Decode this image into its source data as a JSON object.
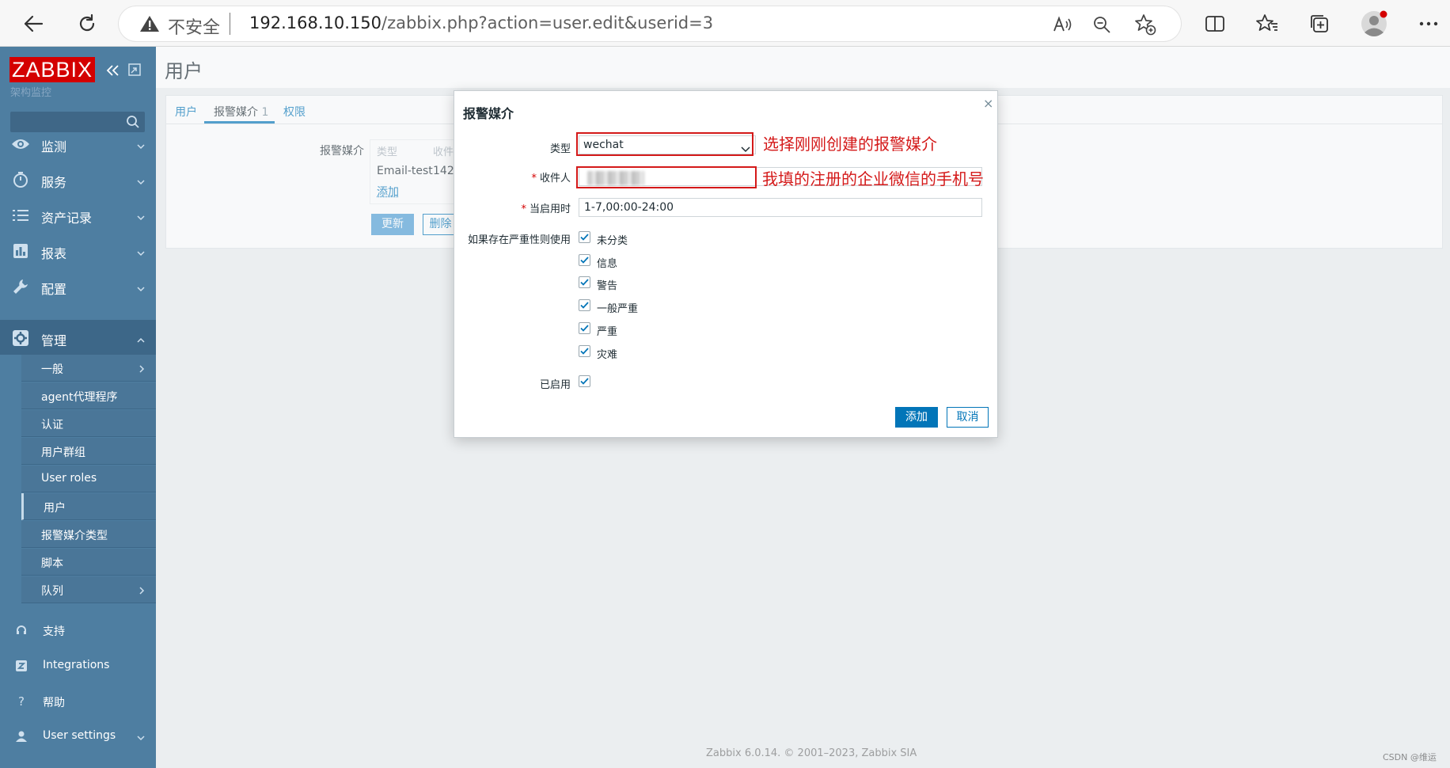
{
  "browser": {
    "insecure_label": "不安全",
    "url_host": "192.168.10.150",
    "url_path": "/zabbix.php?action=user.edit&userid=3",
    "icons": [
      "back-icon",
      "refresh-icon",
      "warning-icon",
      "read-aloud-icon",
      "zoom-out-icon",
      "favorite-add-icon",
      "split-screen-icon",
      "favorites-icon",
      "collections-icon",
      "profile-avatar",
      "more-icon"
    ]
  },
  "sidebar": {
    "logo": "ZABBIX",
    "subtitle": "架构监控",
    "menu": [
      {
        "label": "监测",
        "icon": "eye-icon"
      },
      {
        "label": "服务",
        "icon": "clock-icon"
      },
      {
        "label": "资产记录",
        "icon": "list-icon"
      },
      {
        "label": "报表",
        "icon": "bar-chart-icon"
      },
      {
        "label": "配置",
        "icon": "wrench-icon"
      },
      {
        "label": "管理",
        "icon": "gear-icon"
      }
    ],
    "submenu": [
      {
        "label": "一般"
      },
      {
        "label": "agent代理程序"
      },
      {
        "label": "认证"
      },
      {
        "label": "用户群组"
      },
      {
        "label": "User roles"
      },
      {
        "label": "用户"
      },
      {
        "label": "报警媒介类型"
      },
      {
        "label": "脚本"
      },
      {
        "label": "队列"
      }
    ],
    "bottom": [
      {
        "label": "支持",
        "icon": "headset-icon"
      },
      {
        "label": "Integrations",
        "icon": "z-icon"
      },
      {
        "label": "帮助",
        "icon": "help-icon"
      },
      {
        "label": "User settings",
        "icon": "user-icon"
      }
    ]
  },
  "page": {
    "title": "用户",
    "tabs": {
      "users": "用户",
      "media": "报警媒介",
      "media_count": "1",
      "permissions": "权限"
    },
    "media_label": "报警媒介",
    "table_head": {
      "type": "类型",
      "sendto": "收件"
    },
    "row": {
      "type": "Email-test",
      "sendto": "142"
    },
    "add_link": "添加",
    "update_btn": "更新",
    "delete_btn": "删除",
    "footer": "Zabbix 6.0.14. © 2001–2023, Zabbix SIA",
    "watermark": "CSDN @维运"
  },
  "modal": {
    "title": "报警媒介",
    "close": "×",
    "type_label": "类型",
    "type_value": "wechat",
    "sendto_label": "收件人",
    "active_label": "当启用时",
    "active_value": "1-7,00:00-24:00",
    "severity_label": "如果存在严重性则使用",
    "severities": [
      "未分类",
      "信息",
      "警告",
      "一般严重",
      "严重",
      "灾难"
    ],
    "enabled_label": "已启用",
    "add_btn": "添加",
    "cancel_btn": "取消"
  },
  "annotations": {
    "type_note": "选择刚刚创建的报警媒介",
    "sendto_note": "我填的注册的企业微信的手机号"
  },
  "colors": {
    "sidebar": "#4e7ea1",
    "logo_red": "#d40000",
    "link_blue": "#0275b8",
    "annotation_red": "#d41919"
  }
}
